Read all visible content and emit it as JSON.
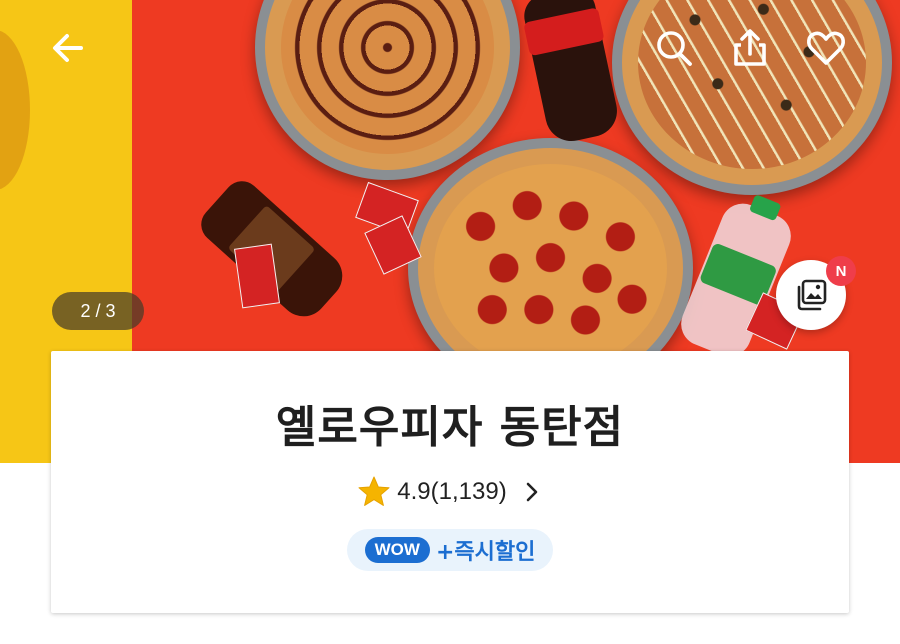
{
  "nav": {
    "back_icon": "arrow-left-icon",
    "search_icon": "search-icon",
    "share_icon": "share-icon",
    "favorite_icon": "heart-icon"
  },
  "gallery": {
    "pager": "2 / 3",
    "photo_button_icon": "photo-gallery-icon",
    "new_badge": "N"
  },
  "store": {
    "name": "옐로우피자 동탄점",
    "rating": "4.9",
    "review_count": "(1,139)",
    "rating_icon": "star-icon",
    "wow_badge": "WOW",
    "wow_text": "+즉시할인"
  },
  "colors": {
    "accent_blue": "#1c6ed1",
    "star_yellow": "#f5b400",
    "badge_red": "#ef3d4a",
    "hero_red": "#ee3a22",
    "hero_yellow": "#f6c616"
  }
}
